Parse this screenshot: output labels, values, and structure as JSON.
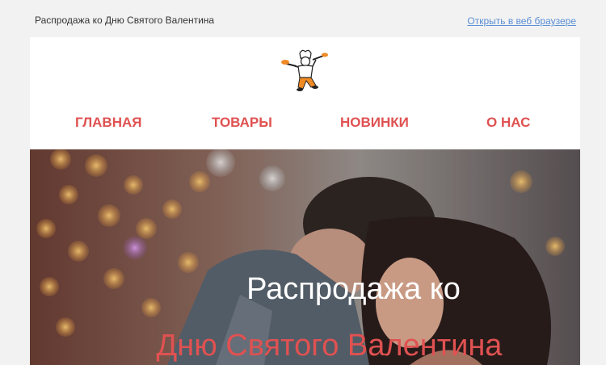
{
  "preheader": {
    "title": "Распродажа ко Дню Святого Валентина",
    "browser_link": "Открыть в веб браузере"
  },
  "logo": {
    "icon": "chef-mascot-icon"
  },
  "nav": {
    "items": [
      {
        "label": "ГЛАВНАЯ"
      },
      {
        "label": "ТОВАРЫ"
      },
      {
        "label": "НОВИНКИ"
      },
      {
        "label": "О НАС"
      }
    ]
  },
  "hero": {
    "line1": "Распродажа ко",
    "line2": "Дню Святого Валентина"
  },
  "colors": {
    "accent": "#e05151",
    "link": "#5b8fd6",
    "background": "#f2f2f2"
  }
}
